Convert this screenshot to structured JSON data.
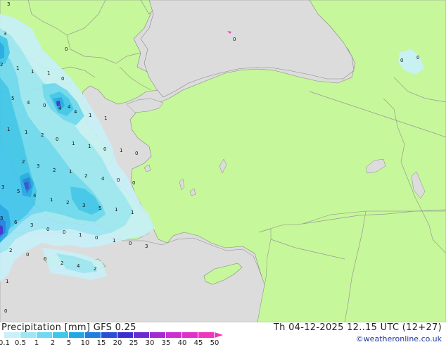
{
  "colors": {
    "sea": "#dcdcdc",
    "land": "#c6f79a",
    "border": "#999999",
    "coast": "#888888",
    "precip_scale": [
      "#c8f0f8",
      "#9ee6f6",
      "#6fd8f2",
      "#3fc6ee",
      "#21a9e6",
      "#1f7fde",
      "#2a4fd6",
      "#3b2fd0",
      "#6a2bd0",
      "#a22bd2",
      "#cc2ecf",
      "#e030c8",
      "#ee36bc"
    ]
  },
  "legend": {
    "title": "Precipitation [mm]  GFS 0.25",
    "datetime": "Th 04-12-2025 12..15 UTC (12+27)",
    "credit": "©weatheronline.co.uk",
    "scale_labels": [
      "0.1",
      "0.5",
      "1",
      "2",
      "5",
      "10",
      "15",
      "20",
      "25",
      "30",
      "35",
      "40",
      "45",
      "50"
    ]
  },
  "map_values": [
    {
      "id": "v-a",
      "text": "3"
    },
    {
      "id": "v-b",
      "text": "3"
    },
    {
      "id": "v-c",
      "text": "0"
    },
    {
      "id": "v-d",
      "text": "0"
    },
    {
      "id": "v-e",
      "text": "0"
    },
    {
      "id": "v-f",
      "text": "0"
    },
    {
      "id": "v-g",
      "text": "2"
    },
    {
      "id": "v-h",
      "text": "1"
    },
    {
      "id": "v-i",
      "text": "1"
    },
    {
      "id": "v-j",
      "text": "1"
    },
    {
      "id": "v-k",
      "text": "0"
    },
    {
      "id": "v-l",
      "text": "5"
    },
    {
      "id": "v-m",
      "text": "4"
    },
    {
      "id": "v-n",
      "text": "0"
    },
    {
      "id": "v-o",
      "text": "4"
    },
    {
      "id": "v-p",
      "text": "4"
    },
    {
      "id": "v-q",
      "text": "4"
    },
    {
      "id": "v-r",
      "text": "1"
    },
    {
      "id": "v-s",
      "text": "1"
    },
    {
      "id": "v-t",
      "text": "1"
    },
    {
      "id": "v-u",
      "text": "1"
    },
    {
      "id": "v-v",
      "text": "2"
    },
    {
      "id": "v-w",
      "text": "0"
    },
    {
      "id": "v-x",
      "text": "1"
    },
    {
      "id": "v-y",
      "text": "1"
    },
    {
      "id": "v-z",
      "text": "0"
    },
    {
      "id": "v-aa",
      "text": "1"
    },
    {
      "id": "v-ab",
      "text": "0"
    },
    {
      "id": "v-ac",
      "text": "2"
    },
    {
      "id": "v-ad",
      "text": "3"
    },
    {
      "id": "v-ae",
      "text": "2"
    },
    {
      "id": "v-af",
      "text": "1"
    },
    {
      "id": "v-ag",
      "text": "2"
    },
    {
      "id": "v-ah",
      "text": "4"
    },
    {
      "id": "v-ai",
      "text": "0"
    },
    {
      "id": "v-aj",
      "text": "3"
    },
    {
      "id": "v-ak",
      "text": "5"
    },
    {
      "id": "v-al",
      "text": "4"
    },
    {
      "id": "v-am",
      "text": "1"
    },
    {
      "id": "v-an",
      "text": "2"
    },
    {
      "id": "v-ao",
      "text": "3"
    },
    {
      "id": "v-ap",
      "text": "5"
    },
    {
      "id": "v-aq",
      "text": "1"
    },
    {
      "id": "v-ar",
      "text": "1"
    },
    {
      "id": "v-as",
      "text": "3"
    },
    {
      "id": "v-at",
      "text": "6"
    },
    {
      "id": "v-au",
      "text": "3"
    },
    {
      "id": "v-av",
      "text": "0"
    },
    {
      "id": "v-aw",
      "text": "0"
    },
    {
      "id": "v-ax",
      "text": "1"
    },
    {
      "id": "v-ay",
      "text": "0"
    },
    {
      "id": "v-az",
      "text": "1"
    },
    {
      "id": "v-ba",
      "text": "0"
    },
    {
      "id": "v-bb",
      "text": "3"
    },
    {
      "id": "v-bc",
      "text": "2"
    },
    {
      "id": "v-bd",
      "text": "0"
    },
    {
      "id": "v-be",
      "text": "0"
    },
    {
      "id": "v-bf",
      "text": "2"
    },
    {
      "id": "v-bg",
      "text": "4"
    },
    {
      "id": "v-bh",
      "text": "2"
    },
    {
      "id": "v-bi",
      "text": "1"
    },
    {
      "id": "v-bj",
      "text": "0"
    },
    {
      "id": "v-bk",
      "text": "0"
    }
  ]
}
